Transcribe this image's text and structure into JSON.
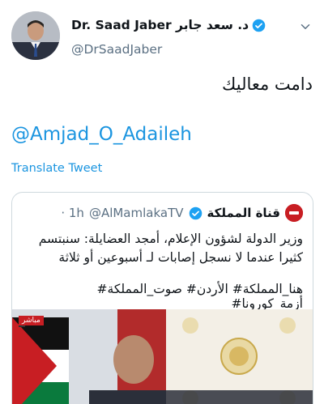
{
  "author": {
    "name": "Dr. Saad Jaber د. سعد جابر",
    "handle": "@DrSaadJaber"
  },
  "tweet": {
    "text": "دامت معاليك",
    "mention": "@Amjad_O_Adaileh",
    "translate_label": "Translate Tweet"
  },
  "quoted": {
    "name": "قناة المملكة",
    "handle": "@AlMamlakaTV",
    "age": "· 1h",
    "body": "وزير الدولة لشؤون الإعلام، أمجد العضايلة: سنبتسم كثيرا عندما لا نسجل إصابات لـ أسبوعين أو ثلاثة",
    "hashtags": "هنا_المملكة# الأردن# صوت_المملكة# أزمة_كورونا#",
    "media_live_label": "مباشر"
  },
  "colors": {
    "link": "#1b95e0",
    "muted": "#5b7083",
    "verified": "#1da1f2",
    "brand_red": "#c81e23"
  }
}
